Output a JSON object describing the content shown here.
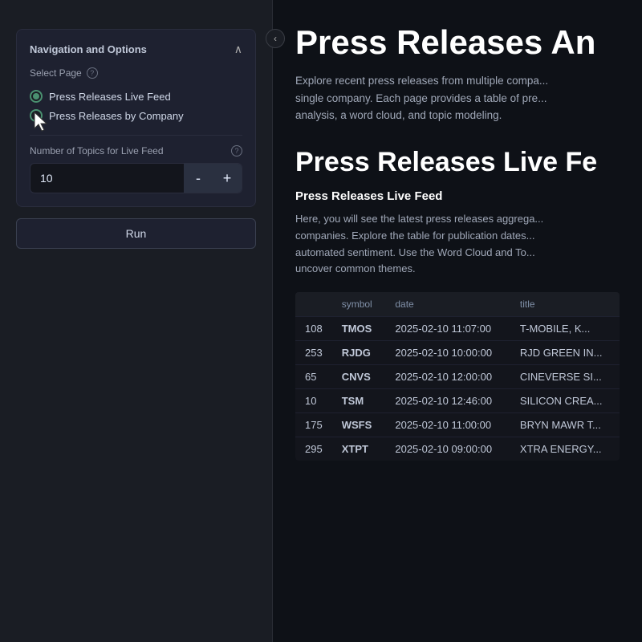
{
  "sidebar": {
    "collapse_icon": "‹",
    "section_title": "Navigation and Options",
    "select_page_label": "Select Page",
    "help_tooltip": "?",
    "pages": [
      {
        "id": "live-feed",
        "label": "Press Releases Live Feed",
        "selected": true
      },
      {
        "id": "by-company",
        "label": "Press Releases by Company",
        "selected": false
      }
    ],
    "topics_label": "Number of Topics for Live Feed",
    "topics_value": "10",
    "decrement_label": "-",
    "increment_label": "+",
    "run_label": "Run"
  },
  "main": {
    "title": "Press Releases An",
    "description": "Explore recent press releases from multiple compa... single company. Each page provides a table of pre... analysis, a word cloud, and topic modeling.",
    "live_feed_heading": "Press Releases Live Fe",
    "subsection_heading": "Press Releases Live Feed",
    "feed_description": "Here, you will see the latest press releases aggrega... companies. Explore the table for publication dates... automated sentiment. Use the Word Cloud and To... uncover common themes.",
    "table": {
      "columns": [
        "",
        "symbol",
        "date",
        "title"
      ],
      "rows": [
        {
          "num": "108",
          "symbol": "TMOS",
          "date": "2025-02-10 11:07:00",
          "title": "T-MOBILE, K..."
        },
        {
          "num": "253",
          "symbol": "RJDG",
          "date": "2025-02-10 10:00:00",
          "title": "RJD GREEN IN..."
        },
        {
          "num": "65",
          "symbol": "CNVS",
          "date": "2025-02-10 12:00:00",
          "title": "CINEVERSE SI..."
        },
        {
          "num": "10",
          "symbol": "TSM",
          "date": "2025-02-10 12:46:00",
          "title": "SILICON CREA..."
        },
        {
          "num": "175",
          "symbol": "WSFS",
          "date": "2025-02-10 11:00:00",
          "title": "BRYN MAWR T..."
        },
        {
          "num": "295",
          "symbol": "XTPT",
          "date": "2025-02-10 09:00:00",
          "title": "XTRA ENERGY..."
        }
      ]
    }
  }
}
